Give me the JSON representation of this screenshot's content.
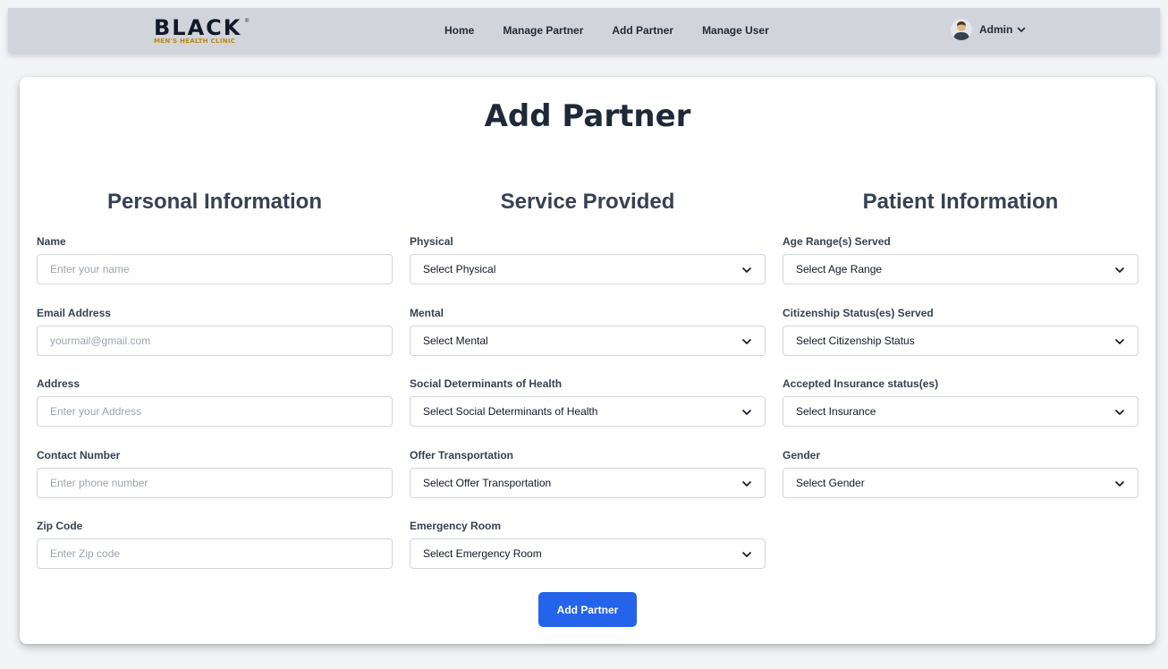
{
  "navbar": {
    "logo": {
      "main": "BLACK",
      "tm": "®",
      "sub": "MEN'S HEALTH CLINIC"
    },
    "links": [
      {
        "label": "Home"
      },
      {
        "label": "Manage Partner"
      },
      {
        "label": "Add Partner"
      },
      {
        "label": "Manage User"
      }
    ],
    "user": {
      "name": "Admin",
      "avatar_icon": "user-avatar",
      "chevron_icon": "chevron-down-icon"
    }
  },
  "page": {
    "title": "Add Partner"
  },
  "sections": {
    "personal": {
      "heading": "Personal Information",
      "fields": [
        {
          "label": "Name",
          "placeholder": "Enter your name",
          "value": ""
        },
        {
          "label": "Email Address",
          "placeholder": "yourmail@gmail.com",
          "value": ""
        },
        {
          "label": "Address",
          "placeholder": "Enter your Address",
          "value": ""
        },
        {
          "label": "Contact Number",
          "placeholder": "Enter phone number",
          "value": ""
        },
        {
          "label": "Zip Code",
          "placeholder": "Enter Zip code",
          "value": ""
        }
      ]
    },
    "service": {
      "heading": "Service Provided",
      "fields": [
        {
          "label": "Physical",
          "selected": "Select Physical"
        },
        {
          "label": "Mental",
          "selected": "Select Mental"
        },
        {
          "label": "Social Determinants of Health",
          "selected": "Select Social Determinants of Health"
        },
        {
          "label": "Offer Transportation",
          "selected": "Select Offer Transportation"
        },
        {
          "label": "Emergency Room",
          "selected": "Select Emergency Room"
        }
      ]
    },
    "patient": {
      "heading": "Patient Information",
      "fields": [
        {
          "label": "Age Range(s) Served",
          "selected": "Select Age Range"
        },
        {
          "label": "Citizenship Status(es) Served",
          "selected": "Select Citizenship Status"
        },
        {
          "label": "Accepted Insurance status(es)",
          "selected": "Select Insurance"
        },
        {
          "label": "Gender",
          "selected": "Select Gender"
        }
      ]
    }
  },
  "submit": {
    "label": "Add Partner"
  },
  "colors": {
    "navbar_bg": "#d1d5db",
    "page_bg": "#f3f4f6",
    "card_bg": "#ffffff",
    "primary": "#2563eb",
    "heading_text": "#1f2937",
    "label_text": "#374151",
    "placeholder": "#9ca3af",
    "border": "#d1d5db",
    "logo_accent": "#b8860b"
  }
}
